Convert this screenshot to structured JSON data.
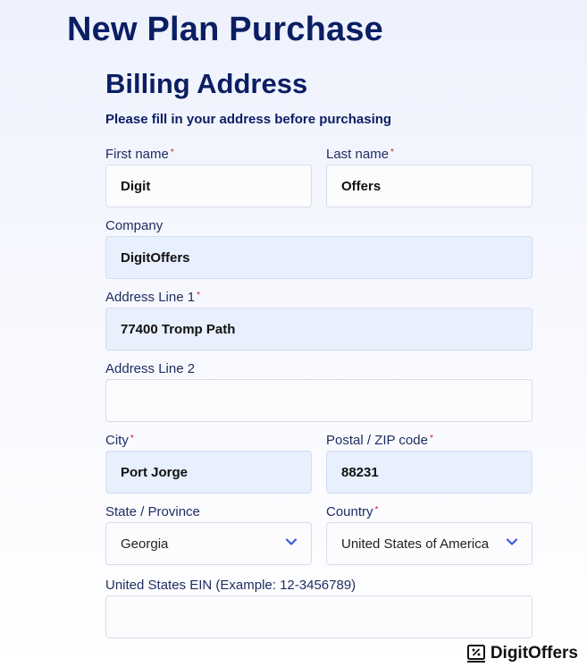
{
  "header": {
    "title": "New Plan Purchase"
  },
  "section": {
    "title": "Billing Address",
    "subtitle": "Please fill in your address before purchasing"
  },
  "fields": {
    "first_name": {
      "label": "First name",
      "required_mark": "*",
      "value": "Digit"
    },
    "last_name": {
      "label": "Last name",
      "required_mark": "*",
      "value": "Offers"
    },
    "company": {
      "label": "Company",
      "value": "DigitOffers"
    },
    "address1": {
      "label": "Address Line 1",
      "required_mark": "*",
      "value": "77400 Tromp Path"
    },
    "address2": {
      "label": "Address Line 2",
      "value": ""
    },
    "city": {
      "label": "City",
      "required_mark": "*",
      "value": "Port Jorge"
    },
    "postal": {
      "label": "Postal / ZIP code",
      "required_mark": "*",
      "value": "88231"
    },
    "state": {
      "label": "State / Province",
      "value": "Georgia"
    },
    "country": {
      "label": "Country",
      "required_mark": "*",
      "value": "United States of America"
    },
    "ein": {
      "label": "United States EIN (Example: 12-3456789)",
      "value": ""
    }
  },
  "watermark": {
    "text": "DigitOffers"
  },
  "colors": {
    "heading": "#0b1e64",
    "filled_bg": "#e8effd",
    "required": "#d0182f",
    "chevron": "#3b5bdb"
  }
}
